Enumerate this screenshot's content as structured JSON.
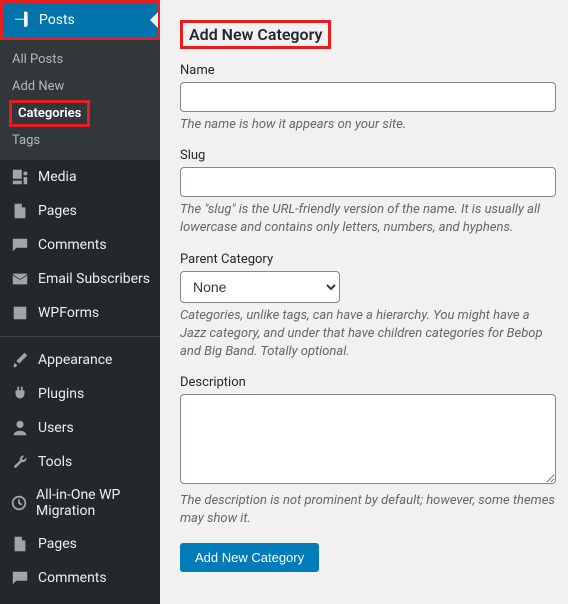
{
  "sidebar": {
    "top": {
      "label": "Posts"
    },
    "submenu": [
      {
        "label": "All Posts"
      },
      {
        "label": "Add New"
      },
      {
        "label": "Categories"
      },
      {
        "label": "Tags"
      }
    ],
    "items": [
      {
        "label": "Media"
      },
      {
        "label": "Pages"
      },
      {
        "label": "Comments"
      },
      {
        "label": "Email Subscribers"
      },
      {
        "label": "WPForms"
      },
      {
        "label": "Appearance"
      },
      {
        "label": "Plugins"
      },
      {
        "label": "Users"
      },
      {
        "label": "Tools"
      },
      {
        "label": "All-in-One WP Migration"
      },
      {
        "label": "Pages"
      },
      {
        "label": "Comments"
      }
    ]
  },
  "form": {
    "title": "Add New Category",
    "name": {
      "label": "Name",
      "desc": "The name is how it appears on your site."
    },
    "slug": {
      "label": "Slug",
      "desc": "The \"slug\" is the URL-friendly version of the name. It is usually all lowercase and contains only letters, numbers, and hyphens."
    },
    "parent": {
      "label": "Parent Category",
      "selected": "None",
      "desc": "Categories, unlike tags, can have a hierarchy. You might have a Jazz category, and under that have children categories for Bebop and Big Band. Totally optional."
    },
    "description": {
      "label": "Description",
      "desc": "The description is not prominent by default; however, some themes may show it."
    },
    "submit": "Add New Category"
  }
}
